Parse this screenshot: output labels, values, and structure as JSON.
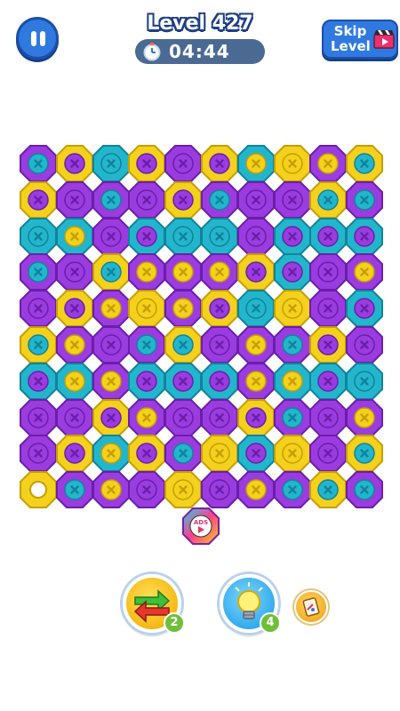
{
  "header": {
    "level_label": "Level 427",
    "timer_text": "04:44",
    "skip_label_line1": "Skip",
    "skip_label_line2": "Level"
  },
  "colors": {
    "purple": "#9a3ce0",
    "yellow": "#f3d11c",
    "cyan": "#22b6cc",
    "accent_blue": "#2f79e0",
    "badge_green": "#6fbf3a"
  },
  "board": {
    "rows": 10,
    "cols": 10,
    "cells": [
      [
        [
          "p",
          "c"
        ],
        [
          "y",
          "p"
        ],
        [
          "c",
          "c"
        ],
        [
          "y",
          "p"
        ],
        [
          "p",
          "p"
        ],
        [
          "y",
          "p"
        ],
        [
          "c",
          "y"
        ],
        [
          "y",
          "y"
        ],
        [
          "p",
          "y"
        ],
        [
          "y",
          "c"
        ]
      ],
      [
        [
          "y",
          "p"
        ],
        [
          "p",
          "p"
        ],
        [
          "p",
          "c"
        ],
        [
          "p",
          "p"
        ],
        [
          "y",
          "p"
        ],
        [
          "p",
          "c"
        ],
        [
          "p",
          "p"
        ],
        [
          "p",
          "p"
        ],
        [
          "y",
          "c"
        ],
        [
          "p",
          "c"
        ]
      ],
      [
        [
          "c",
          "c"
        ],
        [
          "c",
          "y"
        ],
        [
          "p",
          "p"
        ],
        [
          "c",
          "p"
        ],
        [
          "c",
          "c"
        ],
        [
          "c",
          "c"
        ],
        [
          "p",
          "p"
        ],
        [
          "c",
          "p"
        ],
        [
          "c",
          "p"
        ],
        [
          "c",
          "p"
        ]
      ],
      [
        [
          "p",
          "c"
        ],
        [
          "p",
          "p"
        ],
        [
          "y",
          "c"
        ],
        [
          "p",
          "y"
        ],
        [
          "p",
          "y"
        ],
        [
          "p",
          "y"
        ],
        [
          "y",
          "p"
        ],
        [
          "c",
          "p"
        ],
        [
          "p",
          "p"
        ],
        [
          "p",
          "y"
        ]
      ],
      [
        [
          "p",
          "p"
        ],
        [
          "y",
          "p"
        ],
        [
          "p",
          "y"
        ],
        [
          "y",
          "y"
        ],
        [
          "p",
          "y"
        ],
        [
          "y",
          "p"
        ],
        [
          "c",
          "c"
        ],
        [
          "y",
          "y"
        ],
        [
          "p",
          "p"
        ],
        [
          "c",
          "p"
        ]
      ],
      [
        [
          "y",
          "c"
        ],
        [
          "p",
          "y"
        ],
        [
          "p",
          "p"
        ],
        [
          "p",
          "c"
        ],
        [
          "y",
          "c"
        ],
        [
          "p",
          "p"
        ],
        [
          "p",
          "y"
        ],
        [
          "p",
          "c"
        ],
        [
          "y",
          "p"
        ],
        [
          "p",
          "p"
        ]
      ],
      [
        [
          "c",
          "p"
        ],
        [
          "c",
          "y"
        ],
        [
          "p",
          "y"
        ],
        [
          "c",
          "p"
        ],
        [
          "c",
          "p"
        ],
        [
          "c",
          "p"
        ],
        [
          "p",
          "y"
        ],
        [
          "c",
          "y"
        ],
        [
          "c",
          "p"
        ],
        [
          "c",
          "c"
        ]
      ],
      [
        [
          "p",
          "p"
        ],
        [
          "p",
          "p"
        ],
        [
          "y",
          "p"
        ],
        [
          "p",
          "y"
        ],
        [
          "p",
          "p"
        ],
        [
          "p",
          "p"
        ],
        [
          "y",
          "p"
        ],
        [
          "p",
          "c"
        ],
        [
          "p",
          "p"
        ],
        [
          "p",
          "y"
        ]
      ],
      [
        [
          "p",
          "p"
        ],
        [
          "y",
          "p"
        ],
        [
          "c",
          "y"
        ],
        [
          "y",
          "p"
        ],
        [
          "p",
          "c"
        ],
        [
          "y",
          "y"
        ],
        [
          "c",
          "p"
        ],
        [
          "y",
          "y"
        ],
        [
          "p",
          "p"
        ],
        [
          "y",
          "c"
        ]
      ],
      [
        [
          "y",
          "empty"
        ],
        [
          "p",
          "c"
        ],
        [
          "p",
          "y"
        ],
        [
          "p",
          "p"
        ],
        [
          "y",
          "y"
        ],
        [
          "p",
          "p"
        ],
        [
          "p",
          "y"
        ],
        [
          "p",
          "c"
        ],
        [
          "y",
          "c"
        ],
        [
          "p",
          "c"
        ]
      ]
    ]
  },
  "ads_bolt": {
    "label": "ADS"
  },
  "powerups": {
    "swap": {
      "count": "2",
      "icon": "swap-arrows-icon"
    },
    "hint": {
      "count": "4",
      "icon": "lightbulb-icon"
    },
    "extra": {
      "icon": "card-icon"
    }
  }
}
